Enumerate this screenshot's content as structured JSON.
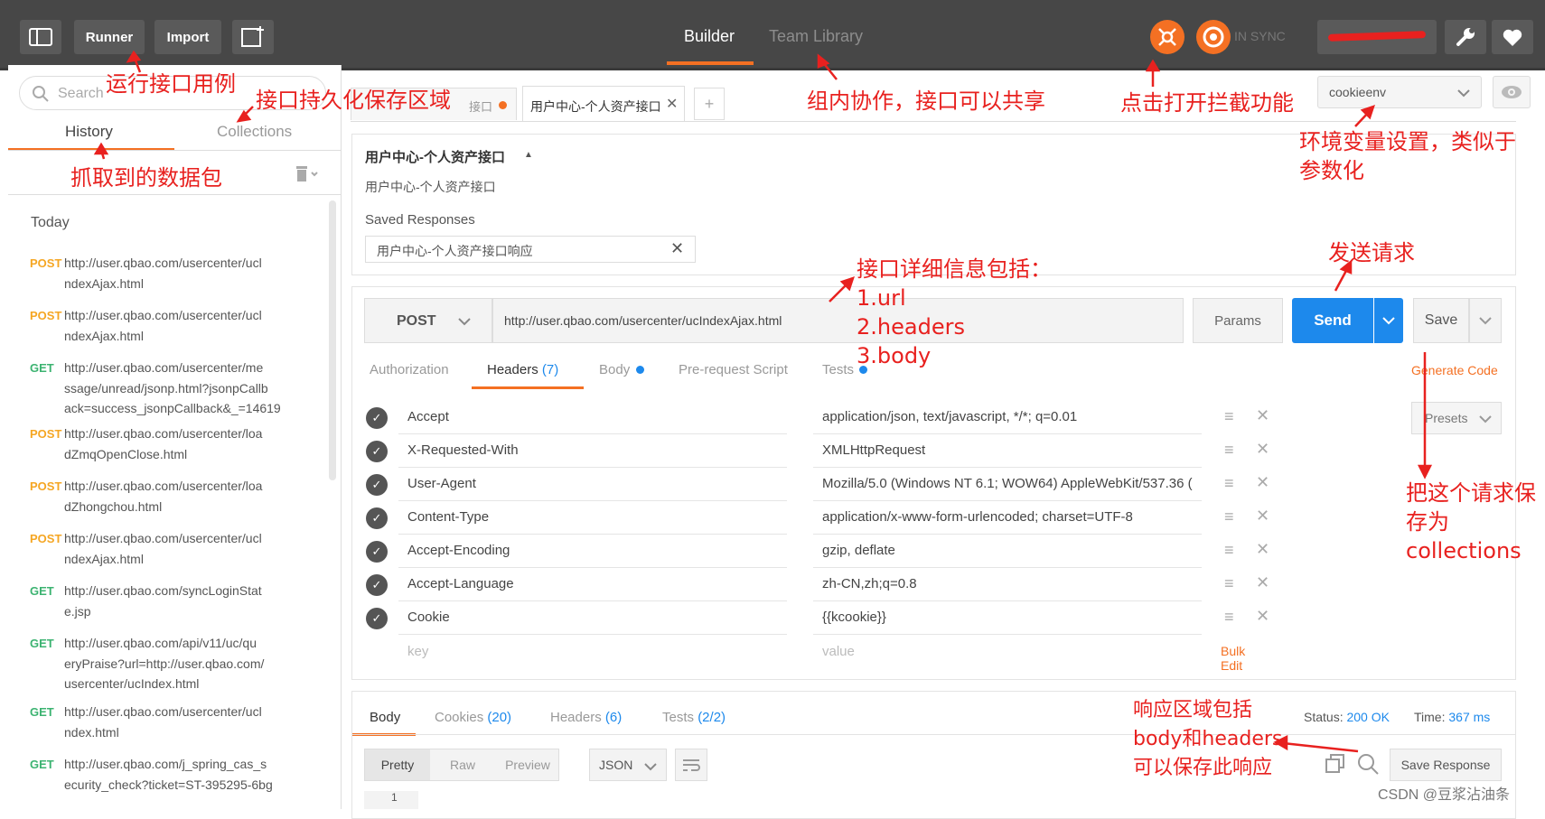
{
  "topbar": {
    "runner_label": "Runner",
    "import_label": "Import",
    "builder_tab": "Builder",
    "team_library_tab": "Team Library",
    "sync_status": "IN SYNC"
  },
  "sidebar": {
    "search_placeholder": "Search",
    "tab_history": "History",
    "tab_collections": "Collections",
    "today_label": "Today",
    "items": [
      {
        "method": "POST",
        "url1": "http://user.qbao.com/usercenter/ucl",
        "url2": "ndexAjax.html",
        "url3": ""
      },
      {
        "method": "POST",
        "url1": "http://user.qbao.com/usercenter/ucl",
        "url2": "ndexAjax.html",
        "url3": ""
      },
      {
        "method": "GET",
        "url1": "http://user.qbao.com/usercenter/me",
        "url2": "ssage/unread/jsonp.html?jsonpCallb",
        "url3": "ack=success_jsonpCallback&_=14619"
      },
      {
        "method": "POST",
        "url1": "http://user.qbao.com/usercenter/loa",
        "url2": "dZmqOpenClose.html",
        "url3": ""
      },
      {
        "method": "POST",
        "url1": "http://user.qbao.com/usercenter/loa",
        "url2": "dZhongchou.html",
        "url3": ""
      },
      {
        "method": "POST",
        "url1": "http://user.qbao.com/usercenter/ucl",
        "url2": "ndexAjax.html",
        "url3": ""
      },
      {
        "method": "GET",
        "url1": "http://user.qbao.com/syncLoginStat",
        "url2": "e.jsp",
        "url3": ""
      },
      {
        "method": "GET",
        "url1": "http://user.qbao.com/api/v11/uc/qu",
        "url2": "eryPraise?url=http://user.qbao.com/",
        "url3": "usercenter/ucIndex.html"
      },
      {
        "method": "GET",
        "url1": "http://user.qbao.com/usercenter/ucl",
        "url2": "ndex.html",
        "url3": ""
      },
      {
        "method": "GET",
        "url1": "http://user.qbao.com/j_spring_cas_s",
        "url2": "ecurity_check?ticket=ST-395295-6bg",
        "url3": ""
      }
    ]
  },
  "request_tabs": {
    "tab1": "接口",
    "tab2": "用户中心-个人资产接口",
    "add": "+"
  },
  "environment": {
    "selected": "cookieenv"
  },
  "request_info": {
    "title": "用户中心-个人资产接口",
    "description": "用户中心-个人资产接口",
    "saved_responses_label": "Saved Responses",
    "saved_response_item": "用户中心-个人资产接口响应"
  },
  "url_bar": {
    "method": "POST",
    "url": "http://user.qbao.com/usercenter/ucIndexAjax.html",
    "params_label": "Params",
    "send_label": "Send",
    "save_label": "Save"
  },
  "req_tabs": {
    "authorization": "Authorization",
    "headers": "Headers",
    "headers_count": "(7)",
    "body": "Body",
    "prerequest": "Pre-request Script",
    "tests": "Tests",
    "generate_code": "Generate Code",
    "presets": "Presets"
  },
  "headers": [
    {
      "key": "Accept",
      "value": "application/json, text/javascript, */*; q=0.01"
    },
    {
      "key": "X-Requested-With",
      "value": "XMLHttpRequest"
    },
    {
      "key": "User-Agent",
      "value": "Mozilla/5.0 (Windows NT 6.1; WOW64) AppleWebKit/537.36 ("
    },
    {
      "key": "Content-Type",
      "value": "application/x-www-form-urlencoded; charset=UTF-8"
    },
    {
      "key": "Accept-Encoding",
      "value": "gzip, deflate"
    },
    {
      "key": "Accept-Language",
      "value": "zh-CN,zh;q=0.8"
    },
    {
      "key": "Cookie",
      "value": "{{kcookie}}"
    }
  ],
  "header_placeholders": {
    "key": "key",
    "value": "value",
    "bulk_edit": "Bulk Edit"
  },
  "response": {
    "tab_body": "Body",
    "tab_cookies": "Cookies",
    "cookies_count": "(20)",
    "tab_headers": "Headers",
    "headers_count": "(6)",
    "tab_tests": "Tests",
    "tests_count": "(2/2)",
    "status_label": "Status:",
    "status_value": "200 OK",
    "time_label": "Time:",
    "time_value": "367 ms",
    "pretty": "Pretty",
    "raw": "Raw",
    "preview": "Preview",
    "format": "JSON",
    "save_response": "Save Response",
    "line_no": "1"
  },
  "annotations": {
    "a_runner": "运行接口用例",
    "a_persist": "接口持久化保存区域",
    "a_packets": "抓取到的数据包",
    "a_team": "组内协作，接口可以共享",
    "a_intercept": "点击打开拦截功能",
    "a_env1": "环境变量设置，类似于",
    "a_env2": "参数化",
    "a_detail": "接口详细信息包括：",
    "a_url": "1.url",
    "a_headers": "2.headers",
    "a_body": "3.body",
    "a_send": "发送请求",
    "a_save1": "把这个请求保",
    "a_save2": "存为",
    "a_save3": "collections",
    "a_resp1": "响应区域包括",
    "a_resp2": "body和headers",
    "a_resp3": "可以保存此响应"
  },
  "watermark": "CSDN @豆浆沾油条",
  "colors": {
    "accent": "#f47023",
    "send_blue": "#1d89ec",
    "annotation": "#e8211f"
  }
}
